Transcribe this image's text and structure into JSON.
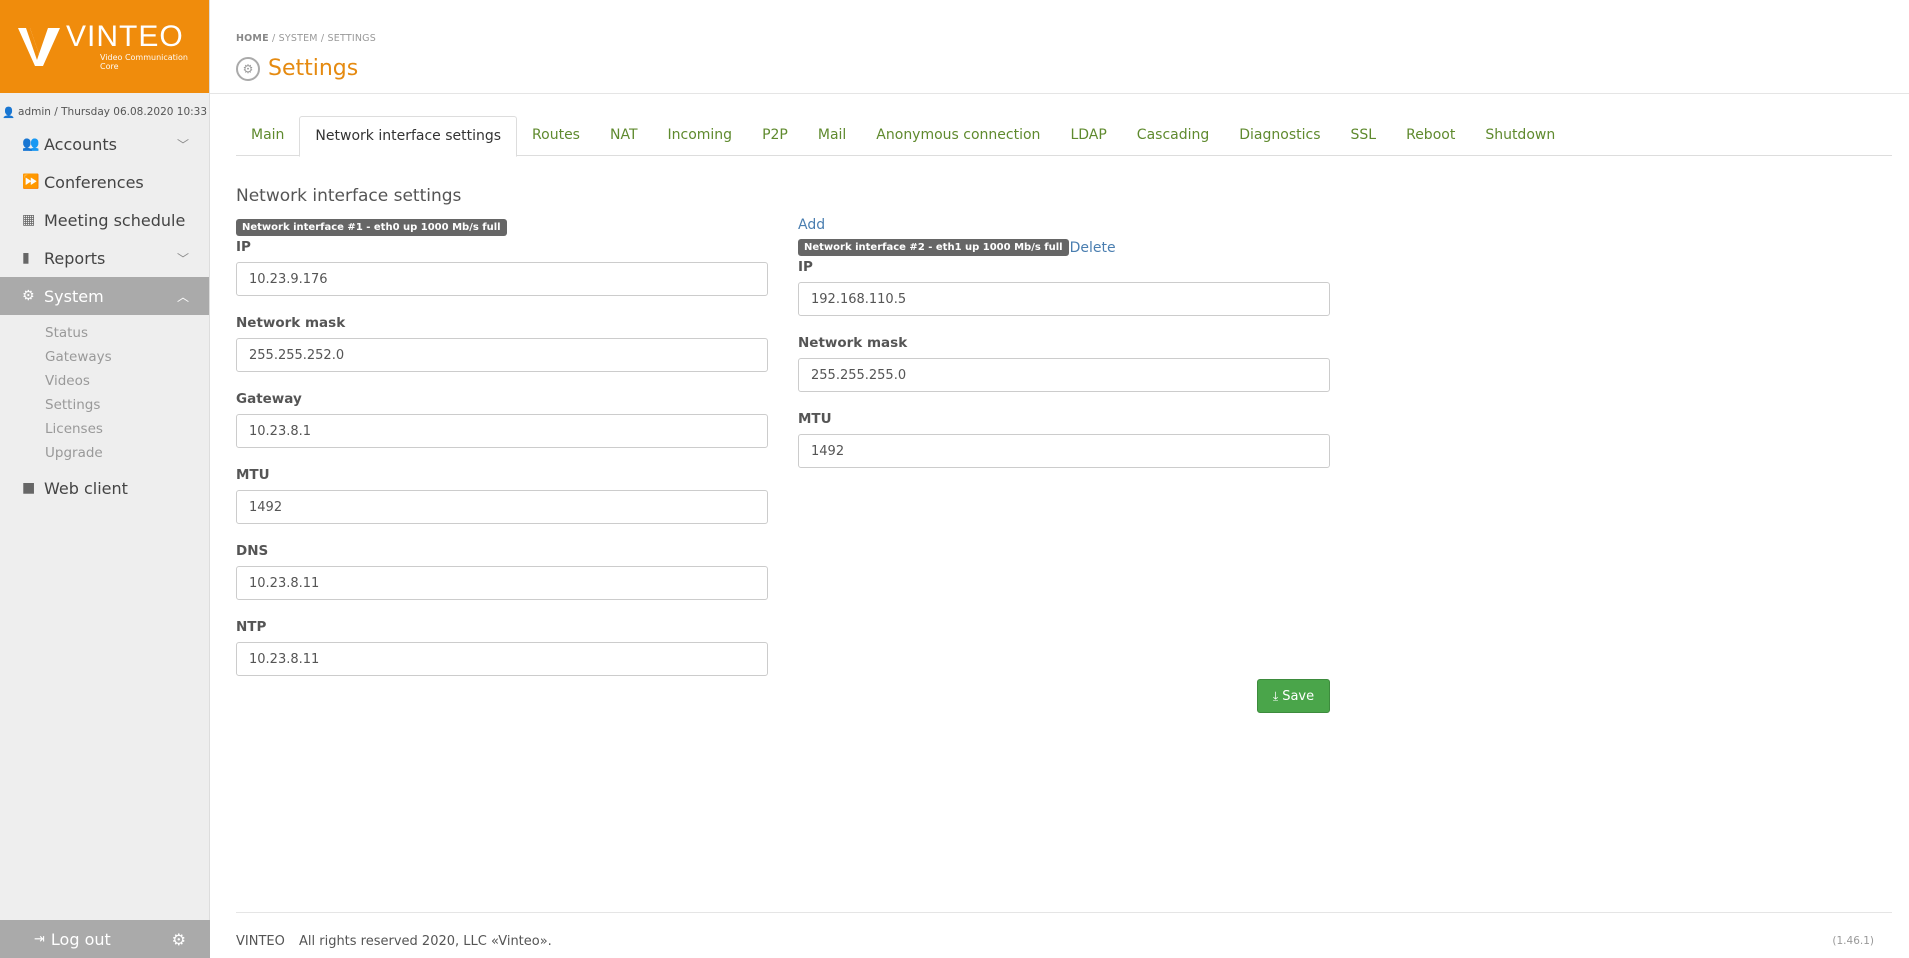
{
  "brand": {
    "name": "VINTEO",
    "tagline": "Video Communication Core",
    "color": "#f08c0c"
  },
  "user": {
    "line": "admin / Thursday 06.08.2020 10:33"
  },
  "sidebar": {
    "items": [
      {
        "label": "Accounts",
        "icon": "users-icon",
        "chevron": "﹀"
      },
      {
        "label": "Conferences",
        "icon": "forward-icon"
      },
      {
        "label": "Meeting schedule",
        "icon": "calendar-icon"
      },
      {
        "label": "Reports",
        "icon": "book-icon",
        "chevron": "﹀"
      },
      {
        "label": "System",
        "icon": "cogs-icon",
        "chevron": "︿"
      },
      {
        "label": "Web client",
        "icon": "video-camera-icon"
      }
    ],
    "system_sub": [
      "Status",
      "Gateways",
      "Videos",
      "Settings",
      "Licenses",
      "Upgrade"
    ],
    "logout": "Log out"
  },
  "breadcrumb": {
    "home": "HOME",
    "sep1": " / ",
    "system": "SYSTEM",
    "sep2": " / ",
    "settings": "SETTINGS"
  },
  "page": {
    "title": "Settings"
  },
  "tabs": [
    "Main",
    "Network interface settings",
    "Routes",
    "NAT",
    "Incoming",
    "P2P",
    "Mail",
    "Anonymous connection",
    "LDAP",
    "Cascading",
    "Diagnostics",
    "SSL",
    "Reboot",
    "Shutdown"
  ],
  "section": {
    "title": "Network interface settings"
  },
  "iface1": {
    "badge": "Network interface #1 - eth0 up 1000 Mb/s full",
    "ip_label": "IP",
    "ip": "10.23.9.176",
    "mask_label": "Network mask",
    "mask": "255.255.252.0",
    "gw_label": "Gateway",
    "gw": "10.23.8.1",
    "mtu_label": "MTU",
    "mtu": "1492",
    "dns_label": "DNS",
    "dns": "10.23.8.11",
    "ntp_label": "NTP",
    "ntp": "10.23.8.11"
  },
  "iface2": {
    "add": "Add",
    "badge": "Network interface #2 - eth1 up 1000 Mb/s full",
    "delete": "Delete",
    "ip_label": "IP",
    "ip": "192.168.110.5",
    "mask_label": "Network mask",
    "mask": "255.255.255.0",
    "mtu_label": "MTU",
    "mtu": "1492"
  },
  "save_label": "Save",
  "footer": {
    "brand": "VINTEO",
    "text": "All rights reserved 2020, LLC «Vinteo».",
    "version": "(1.46.1)"
  }
}
